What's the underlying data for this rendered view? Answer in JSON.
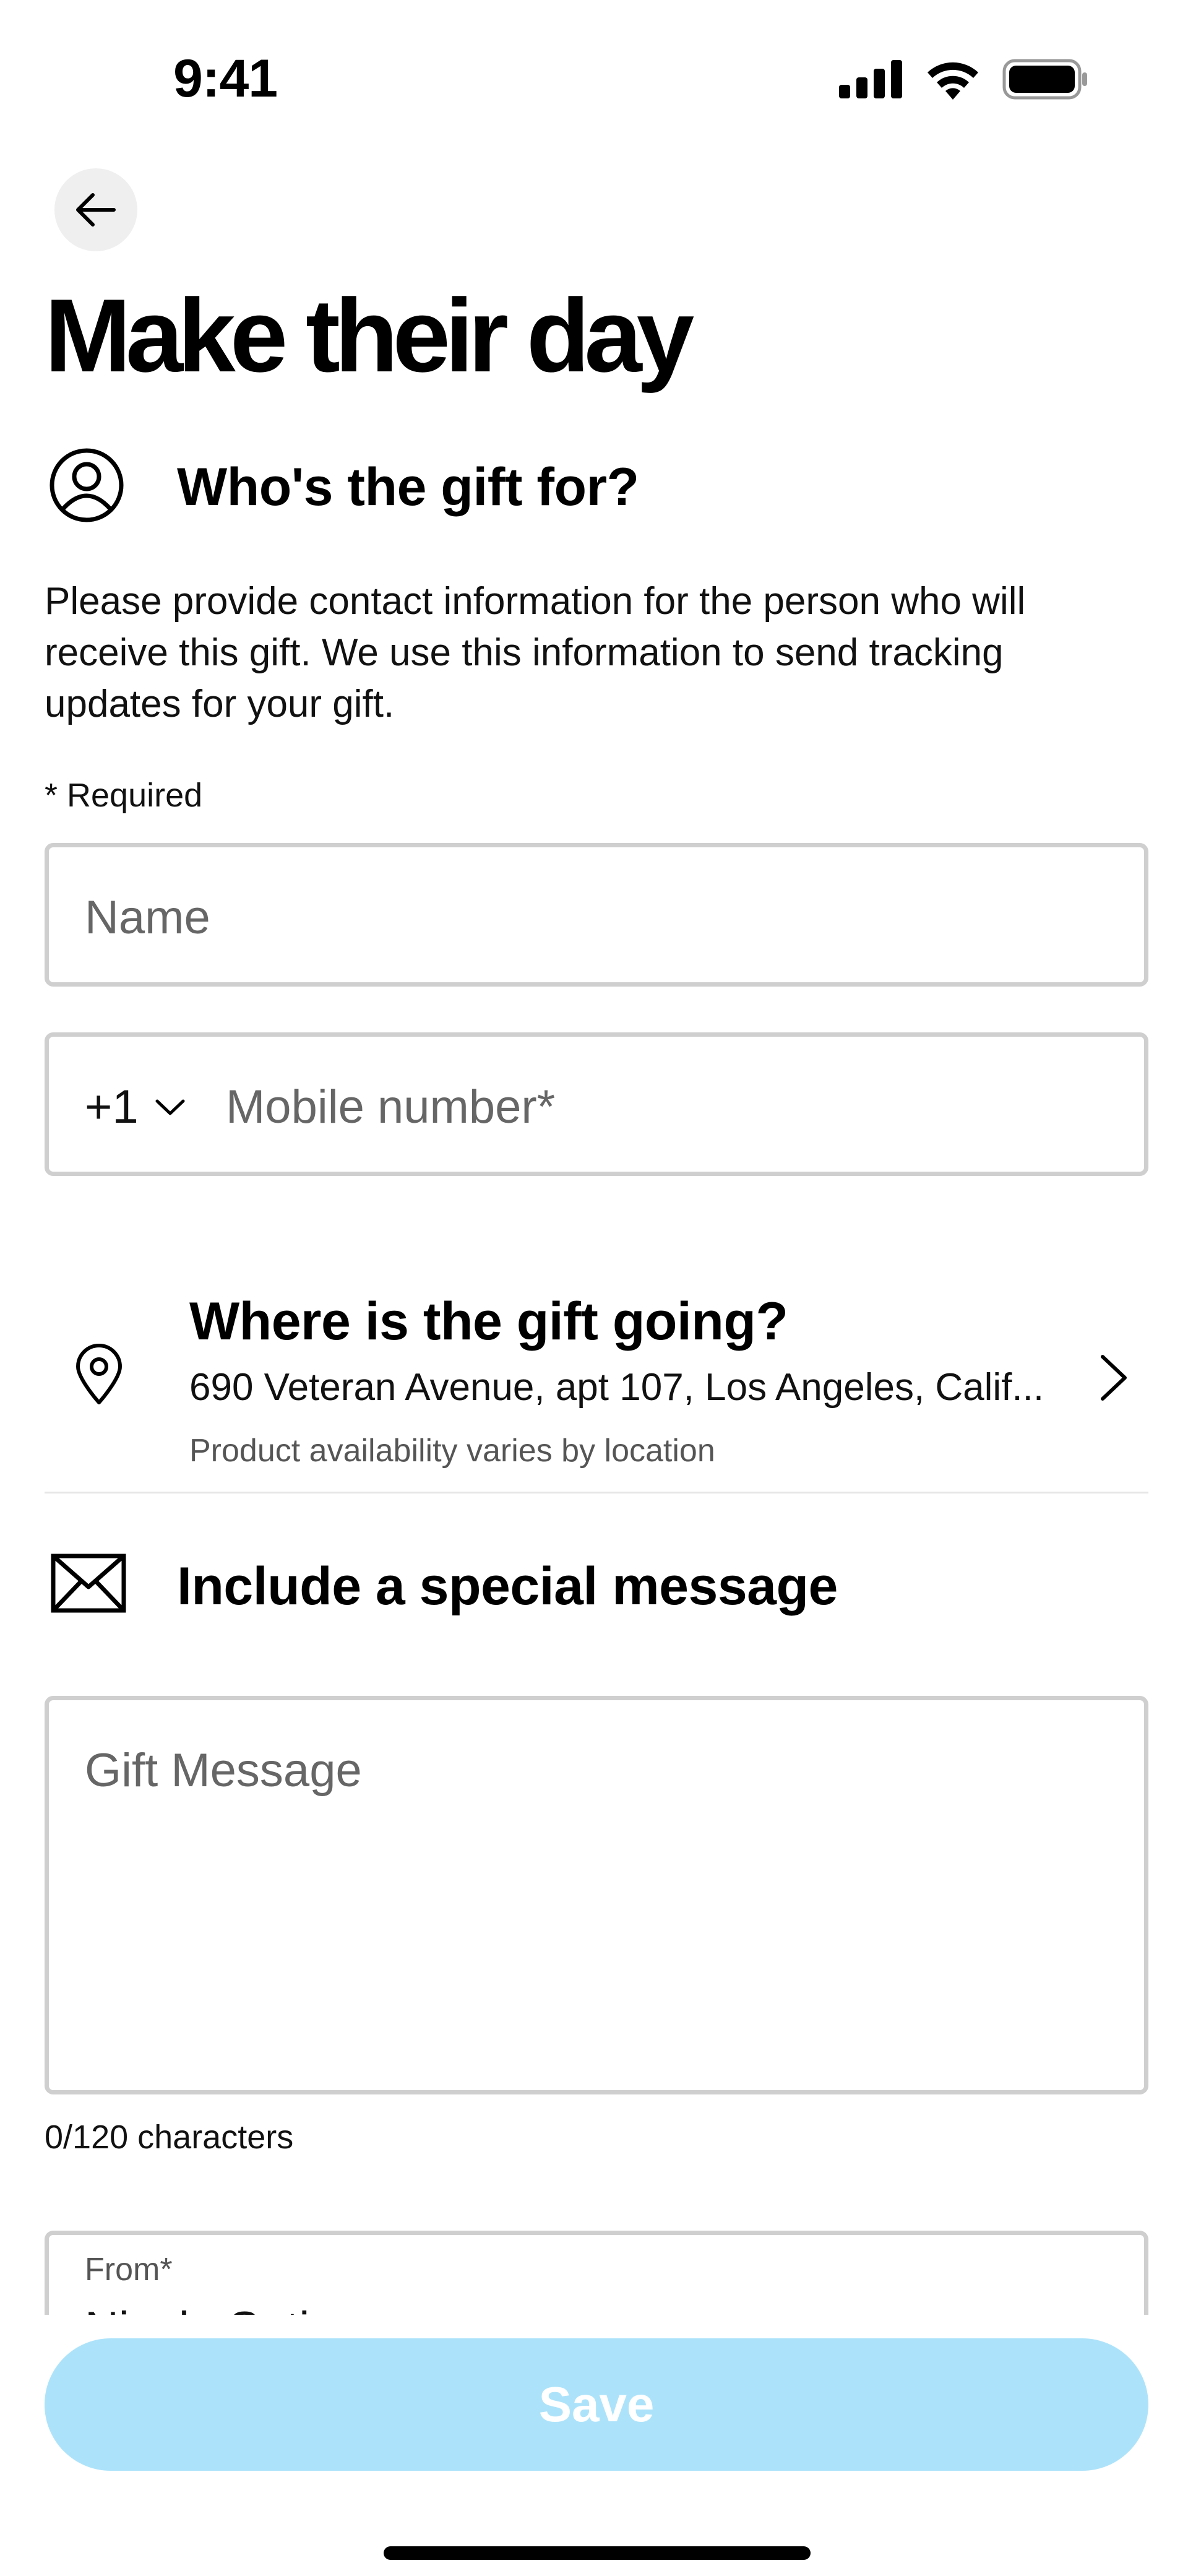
{
  "status_bar": {
    "time": "9:41"
  },
  "header": {
    "title": "Make their day"
  },
  "recipient_section": {
    "heading": "Who's the gift for?",
    "description": "Please provide contact information for the person who will receive this gift. We use this information to send tracking updates for your gift.",
    "required_note": "* Required",
    "name_placeholder": "Name",
    "country_code": "+1",
    "mobile_placeholder": "Mobile number*"
  },
  "address_section": {
    "heading": "Where is the gift going?",
    "address": "690 Veteran Avenue, apt 107, Los Angeles, Calif...",
    "note": "Product availability varies by location"
  },
  "message_section": {
    "heading": "Include a special message",
    "message_placeholder": "Gift Message",
    "char_count": "0/120 characters",
    "from_label": "From*",
    "from_value": "Nicole Satin"
  },
  "footer": {
    "save_label": "Save"
  },
  "colors": {
    "save_button_bg": "#ade3fa",
    "input_border": "#cfcfcf",
    "back_button_bg": "#efefef"
  },
  "icons": [
    "back-arrow-icon",
    "user-circle-icon",
    "chevron-down-icon",
    "location-pin-icon",
    "chevron-right-icon",
    "envelope-icon",
    "signal-icon",
    "wifi-icon",
    "battery-icon"
  ]
}
